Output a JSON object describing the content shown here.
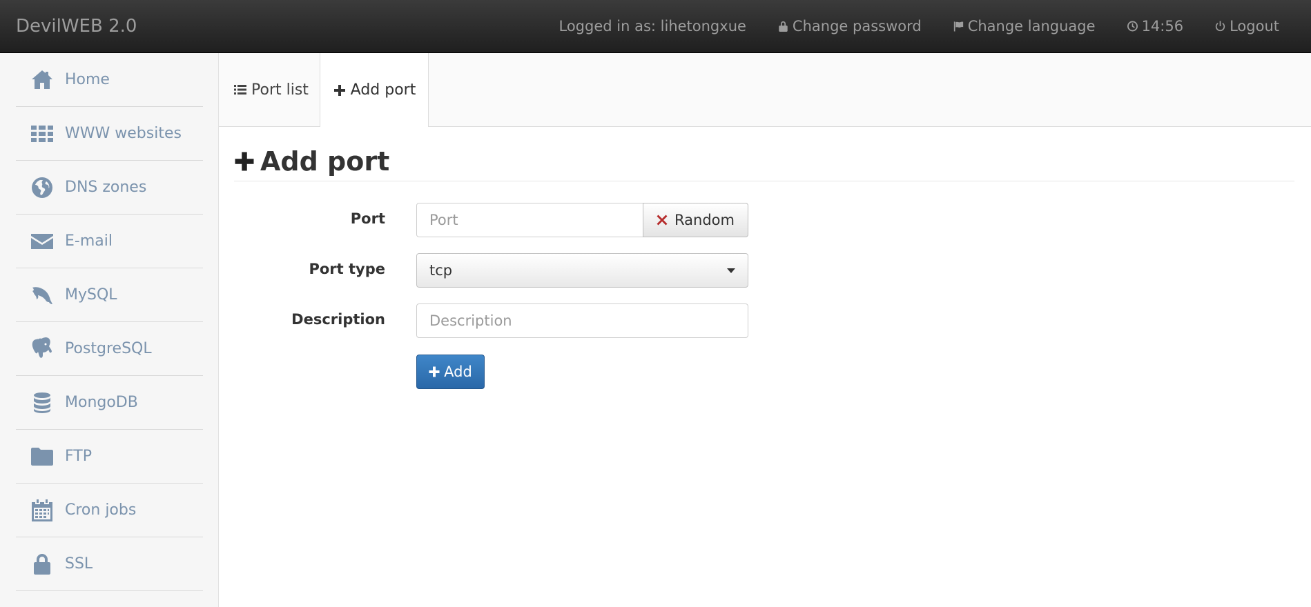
{
  "navbar": {
    "brand": "DevilWEB 2.0",
    "logged_in": "Logged in as: lihetongxue",
    "change_password": "Change password",
    "change_language": "Change language",
    "time": "14:56",
    "logout": "Logout"
  },
  "sidebar": {
    "items": [
      {
        "label": "Home",
        "icon": "home-icon"
      },
      {
        "label": "WWW websites",
        "icon": "grid-icon"
      },
      {
        "label": "DNS zones",
        "icon": "globe-icon"
      },
      {
        "label": "E-mail",
        "icon": "envelope-icon"
      },
      {
        "label": "MySQL",
        "icon": "dolphin-icon"
      },
      {
        "label": "PostgreSQL",
        "icon": "elephant-icon"
      },
      {
        "label": "MongoDB",
        "icon": "database-icon"
      },
      {
        "label": "FTP",
        "icon": "folder-icon"
      },
      {
        "label": "Cron jobs",
        "icon": "calendar-icon"
      },
      {
        "label": "SSL",
        "icon": "lock-icon"
      }
    ]
  },
  "tabs": {
    "port_list": "Port list",
    "add_port": "Add port"
  },
  "main": {
    "title": "Add port"
  },
  "form": {
    "port_label": "Port",
    "port_placeholder": "Port",
    "random_label": "Random",
    "port_type_label": "Port type",
    "port_type_value": "tcp",
    "description_label": "Description",
    "description_placeholder": "Description",
    "add_label": "Add"
  },
  "colors": {
    "navbar_bg": "#2a2a2a",
    "sidebar_text": "#7b93ad",
    "primary_button": "#337ab7",
    "random_icon": "#b52a2a"
  }
}
